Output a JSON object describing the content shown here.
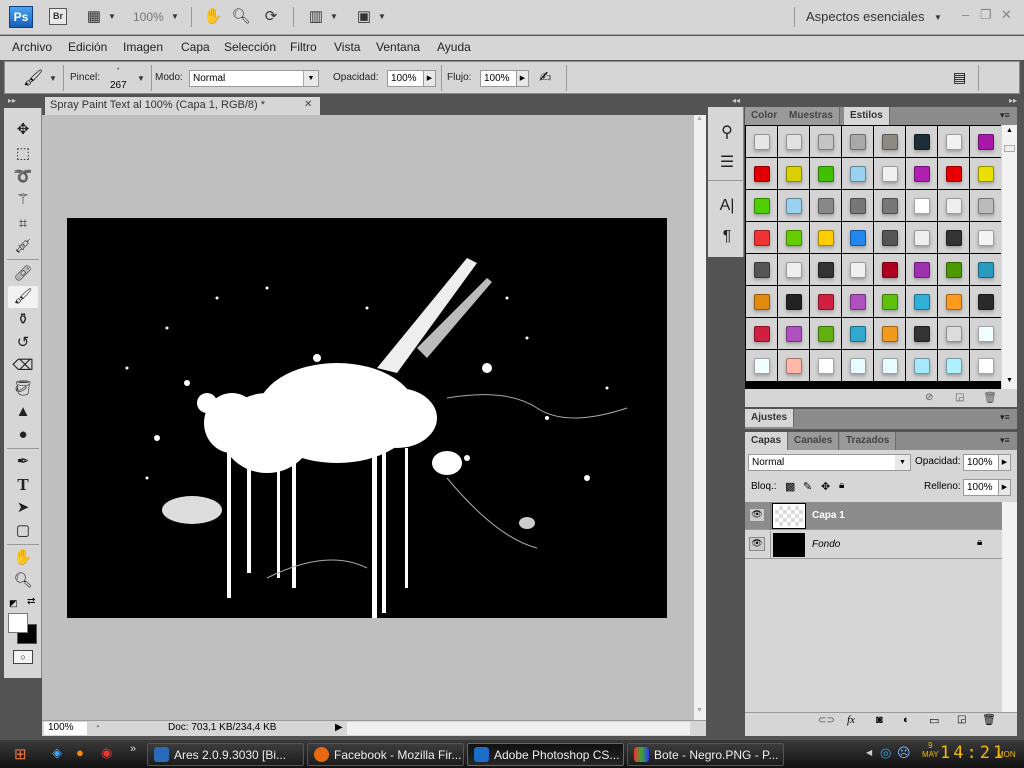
{
  "app_bar": {
    "ps_label": "Ps",
    "br_label": "Br",
    "zoom_value": "100%",
    "workspace": "Aspectos esenciales",
    "icons": [
      "view-extras-icon",
      "hand-icon",
      "zoom-icon",
      "rotate-view-icon",
      "arrange-documents-icon",
      "screen-mode-icon"
    ],
    "window_controls": {
      "minimize": "–",
      "restore": "❐",
      "close": "✕"
    }
  },
  "menu": [
    "Archivo",
    "Edición",
    "Imagen",
    "Capa",
    "Selección",
    "Filtro",
    "Vista",
    "Ventana",
    "Ayuda"
  ],
  "options_bar": {
    "brush_label": "Pincel:",
    "brush_size": "267",
    "mode_label": "Modo:",
    "mode_value": "Normal",
    "opacity_label": "Opacidad:",
    "opacity_value": "100%",
    "flow_label": "Flujo:",
    "flow_value": "100%"
  },
  "document": {
    "tab_title": "Spray Paint Text al 100% (Capa 1, RGB/8) *",
    "close_glyph": "✕",
    "status_zoom": "100%",
    "status_doc": "Doc: 703,1 KB/234,4 KB"
  },
  "tools": [
    "move",
    "rectangular-marquee",
    "lasso",
    "magic-wand",
    "crop",
    "eyedropper",
    "spot-healing-brush",
    "brush",
    "clone-stamp",
    "history-brush",
    "eraser",
    "paint-bucket",
    "blur",
    "dodge",
    "pen",
    "type",
    "path-selection",
    "rectangle",
    "hand",
    "zoom"
  ],
  "colors": {
    "foreground": "#ffffff",
    "background": "#000000",
    "accent": "#1760b8"
  },
  "styles_panel": {
    "tabs": [
      "Color",
      "Muestras",
      "Estilos"
    ],
    "active_tab": "Estilos",
    "swatches": [
      [
        "#e6e6e6",
        "#e2e2e2",
        "#c4c4c4",
        "#a9a9a9",
        "#8e8a82",
        "#1e2e38",
        "#f2f2f2",
        "#a818a8"
      ],
      [
        "#e00000",
        "#d8d000",
        "#40c000",
        "#9ad0f0",
        "#f0f0f0",
        "#b020b0",
        "#e80000",
        "#e8e000"
      ],
      [
        "#50d000",
        "#9ad0f0",
        "#888888",
        "#777777",
        "#777777",
        "#ffffff",
        "#eeeeee",
        "#bbbbbb"
      ],
      [
        "#ee3333",
        "#66cc00",
        "#ffcc00",
        "#2288ee",
        "#555555",
        "#eeeeee",
        "#333333",
        "#f4f4f4"
      ],
      [
        "#555555",
        "#eeeeee",
        "#333333",
        "#f0f0f0",
        "#b00020",
        "#a030b0",
        "#4a9a00",
        "#2a9ac0"
      ],
      [
        "#e08a10",
        "#222222",
        "#d02040",
        "#b050c0",
        "#60c010",
        "#30b0d8",
        "#ff9a20",
        "#2a2a2a"
      ],
      [
        "#d02040",
        "#b050c0",
        "#60b010",
        "#30a8d0",
        "#f09a20",
        "#333333",
        "#dcdcdc",
        "#f0fffc"
      ],
      [
        "#f0fffc",
        "#ffb8a8",
        "#ffffff",
        "#e8fcff",
        "#e8fcff",
        "#a8e8ff",
        "#b0f0ff",
        "#ffffff"
      ]
    ]
  },
  "adjustments_panel": {
    "title": "Ajustes"
  },
  "layers_panel": {
    "tabs": [
      "Capas",
      "Canales",
      "Trazados"
    ],
    "active_tab": "Capas",
    "blend_mode": "Normal",
    "opacity_label": "Opacidad:",
    "opacity_value": "100%",
    "lock_label": "Bloq.:",
    "fill_label": "Relleno:",
    "fill_value": "100%",
    "layers": [
      {
        "name": "Capa 1",
        "visible": true,
        "selected": true
      },
      {
        "name": "Fondo",
        "visible": true,
        "selected": false,
        "locked": true
      }
    ],
    "footer_icons": [
      "link-layers-icon",
      "fx-icon",
      "add-mask-icon",
      "adjustment-layer-icon",
      "new-group-icon",
      "new-layer-icon",
      "delete-icon"
    ]
  },
  "taskbar": {
    "tasks": [
      {
        "label": "Ares 2.0.9.3030   [Bi...",
        "active": false
      },
      {
        "label": "Facebook - Mozilla Fir...",
        "active": false
      },
      {
        "label": "Adobe Photoshop CS...",
        "active": true
      },
      {
        "label": "Bote - Negro.PNG - P...",
        "active": false
      }
    ],
    "clock": {
      "day": "9",
      "month": "MAY",
      "time": "14:21",
      "weekday": "MON"
    },
    "quicklaunch_more": "»"
  }
}
